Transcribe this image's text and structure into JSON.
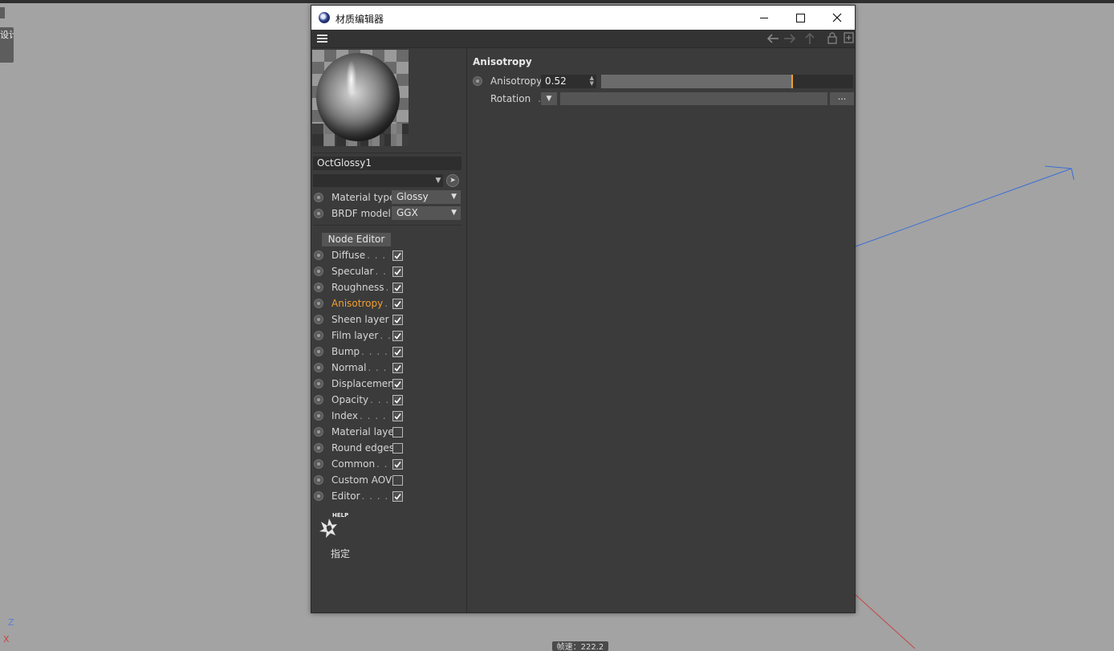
{
  "window": {
    "title": "材质编辑器",
    "buttons": {
      "minimize": "minimize",
      "maximize": "maximize",
      "close": "close"
    }
  },
  "toolbar": {
    "icons": [
      "menu-icon",
      "arrow-left-icon",
      "arrow-right-icon",
      "arrow-up-icon",
      "lock-icon",
      "new-window-icon"
    ]
  },
  "material": {
    "name": "OctGlossy1",
    "material_type_label": "Material type",
    "material_type_value": "Glossy",
    "brdf_label": "BRDF model",
    "brdf_value": "GGX",
    "node_editor_label": "Node Editor"
  },
  "channels": [
    {
      "label": "Diffuse",
      "dots": ". . . . .",
      "checked": true
    },
    {
      "label": "Specular",
      "dots": ". . .",
      "checked": true
    },
    {
      "label": "Roughness",
      "dots": ". .",
      "checked": true
    },
    {
      "label": "Anisotropy",
      "dots": ". .",
      "checked": true,
      "active": true
    },
    {
      "label": "Sheen layer",
      "dots": ".",
      "checked": true
    },
    {
      "label": "Film layer",
      "dots": ". . .",
      "checked": true
    },
    {
      "label": "Bump",
      "dots": ". . . . .",
      "checked": true
    },
    {
      "label": "Normal",
      "dots": ". . . .",
      "checked": true
    },
    {
      "label": "Displacement",
      "dots": "",
      "checked": true
    },
    {
      "label": "Opacity",
      "dots": ". . . .",
      "checked": true
    },
    {
      "label": "Index",
      "dots": ". . . . . .",
      "checked": true
    },
    {
      "label": "Material layer",
      "dots": "",
      "checked": false
    },
    {
      "label": "Round edges",
      "dots": "",
      "checked": false
    },
    {
      "label": "Common",
      "dots": ". . .",
      "checked": true
    },
    {
      "label": "Custom AOV",
      "dots": "",
      "checked": false
    },
    {
      "label": "Editor",
      "dots": ". . . . .",
      "checked": true
    }
  ],
  "help": {
    "badge": "HELP",
    "assign_label": "指定"
  },
  "section": {
    "title": "Anisotropy",
    "anisotropy_label": "Anisotropy",
    "anisotropy_value": "0.52",
    "anisotropy_fraction": 0.755,
    "rotation_label": "Rotation",
    "rotation_dots": ".",
    "ellipsis_label": "..."
  },
  "background": {
    "side_tab_text": "设计",
    "axis_z": "Z",
    "axis_x": "X",
    "status_label": "帧速：222.2"
  },
  "colors": {
    "accent": "#f0a030",
    "panel": "#3b3b3b",
    "axis_blue": "#3b6fd6",
    "axis_red": "#c84444"
  }
}
